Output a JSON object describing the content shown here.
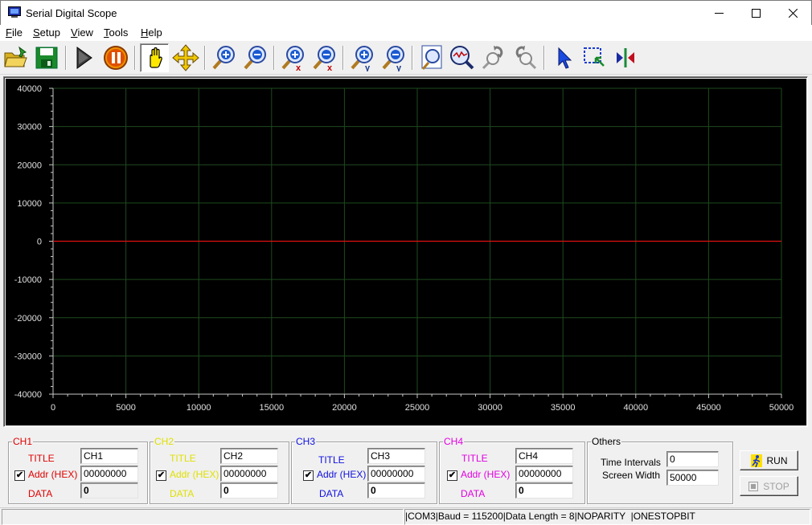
{
  "window": {
    "title": "Serial Digital Scope"
  },
  "menu": [
    "File",
    "Setup",
    "View",
    "Tools",
    "Help"
  ],
  "menu_access_keys": [
    "F",
    "S",
    "V",
    "T",
    "H"
  ],
  "toolbar": {
    "icons": [
      "open-folder-icon",
      "save-icon",
      "play-icon",
      "pause-icon",
      "hand-pan-icon",
      "move-arrows-icon",
      "zoom-in-icon",
      "zoom-out-icon",
      "zoom-in-x-icon",
      "zoom-out-x-icon",
      "zoom-in-y-icon",
      "zoom-out-y-icon",
      "zoom-fit-icon",
      "zoom-search-icon",
      "undo-zoom-icon",
      "redo-zoom-icon",
      "pointer-icon",
      "select-region-icon",
      "cursor-marker-icon"
    ]
  },
  "chart_data": {
    "type": "line",
    "xlim": [
      0,
      50000
    ],
    "ylim": [
      -40000,
      40000
    ],
    "x_ticks": [
      "0",
      "5000",
      "10000",
      "15000",
      "20000",
      "25000",
      "30000",
      "35000",
      "40000",
      "45000",
      "50000"
    ],
    "y_ticks": [
      "40000",
      "30000",
      "20000",
      "10000",
      "0",
      "-10000",
      "-20000",
      "-30000",
      "-40000"
    ],
    "grid": true,
    "background": "#000000",
    "grid_color": "#1e4a1e",
    "series": [
      {
        "color": "#e01010",
        "x": [
          0,
          50000
        ],
        "y": [
          0,
          0
        ]
      }
    ]
  },
  "channels": [
    {
      "caption": "CH1",
      "color": "#e00000",
      "title_label": "TITLE",
      "addr_label": "Addr (HEX)",
      "data_label": "DATA",
      "title_value": "CH1",
      "addr_value": "00000000",
      "data_value": "0",
      "checked": "✔"
    },
    {
      "caption": "CH2",
      "color": "#e0e000",
      "title_label": "TITLE",
      "addr_label": "Addr (HEX)",
      "data_label": "DATA",
      "title_value": "CH2",
      "addr_value": "00000000",
      "data_value": "0",
      "checked": "✔"
    },
    {
      "caption": "CH3",
      "color": "#1010e0",
      "title_label": "TITLE",
      "addr_label": "Addr (HEX)",
      "data_label": "DATA",
      "title_value": "CH3",
      "addr_value": "00000000",
      "data_value": "0",
      "checked": "✔"
    },
    {
      "caption": "CH4",
      "color": "#e000e0",
      "title_label": "TITLE",
      "addr_label": "Addr (HEX)",
      "data_label": "DATA",
      "title_value": "CH4",
      "addr_value": "00000000",
      "data_value": "0",
      "checked": "✔"
    }
  ],
  "others": {
    "caption": "Others",
    "time_intervals_label": "Time Intervals",
    "time_intervals_value": "0",
    "screen_width_label": "Screen Width",
    "screen_width_value": "50000"
  },
  "buttons": {
    "run": "RUN",
    "stop": "STOP"
  },
  "status": "|COM3|Baud = 115200|Data Length = 8|NOPARITY  |ONESTOPBIT"
}
